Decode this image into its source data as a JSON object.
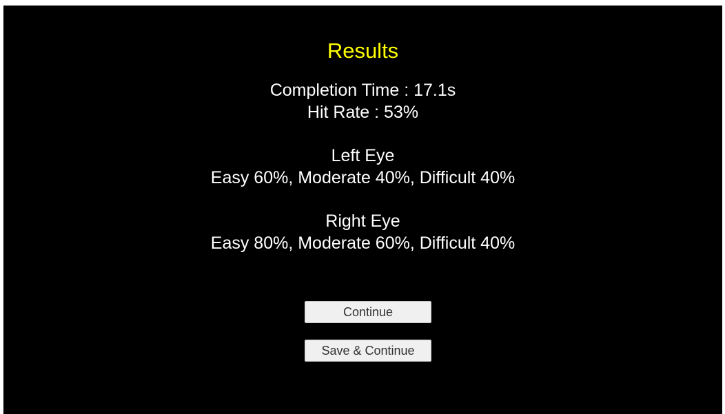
{
  "results": {
    "title": "Results",
    "completion_time": "Completion Time : 17.1s",
    "hit_rate": "Hit Rate : 53%",
    "left_eye": {
      "heading": "Left Eye",
      "breakdown": "Easy 60%, Moderate 40%, Difficult 40%"
    },
    "right_eye": {
      "heading": "Right Eye",
      "breakdown": "Easy 80%, Moderate 60%, Difficult 40%"
    }
  },
  "buttons": {
    "continue_label": "Continue",
    "save_continue_label": "Save & Continue"
  },
  "colors": {
    "background": "#000000",
    "title": "#ffff00",
    "text": "#ffffff",
    "button_bg": "#f0f0f0",
    "button_text": "#323232"
  }
}
